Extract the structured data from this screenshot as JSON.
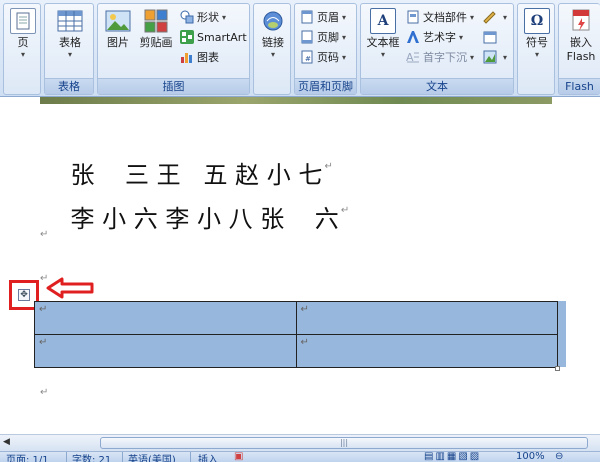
{
  "ribbon": {
    "page_group": {
      "button_label": "页"
    },
    "table_group": {
      "button_label": "表格",
      "group_label": "表格"
    },
    "illustrations_group": {
      "group_label": "插图",
      "picture_label": "图片",
      "clipart_label": "剪贴画",
      "shapes_label": "形状",
      "smartart_label": "SmartArt",
      "chart_label": "图表"
    },
    "links_group": {
      "button_label": "链接"
    },
    "header_footer_group": {
      "group_label": "页眉和页脚",
      "header_label": "页眉",
      "footer_label": "页脚",
      "pagenum_label": "页码"
    },
    "text_group": {
      "group_label": "文本",
      "textbox_label": "文本框",
      "quickparts_label": "文档部件",
      "wordart_label": "艺术字",
      "dropcap_label": "首字下沉"
    },
    "symbols_group": {
      "button_label": "符号"
    },
    "flash_group": {
      "button_label_line1": "嵌入",
      "button_label_line2": "Flash",
      "group_label": "Flash"
    }
  },
  "document": {
    "line1": "张    三 王   五 赵 小 七",
    "line2": "李 小 六 李 小 八 张    六",
    "para_mark": "↵",
    "table": {
      "rows": [
        [
          "↵",
          "↵"
        ],
        [
          "↵",
          "↵"
        ]
      ]
    }
  },
  "statusbar": {
    "page": "页面: 1/1",
    "words": "字数: 21",
    "language": "英语(美国)",
    "mode": "插入",
    "zoom": "100%"
  },
  "colors": {
    "table_selection": "#98b7dc",
    "highlight_box": "#e02020",
    "ribbon_label": "#15428b"
  }
}
